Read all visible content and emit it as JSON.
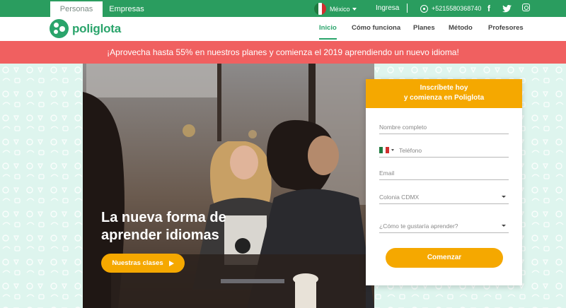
{
  "topbar": {
    "tabs": [
      {
        "label": "Personas",
        "active": true
      },
      {
        "label": "Empresas",
        "active": false
      }
    ],
    "country": "México",
    "login": "Ingresa",
    "phone": "+5215580368740",
    "social": [
      "facebook-icon",
      "twitter-icon",
      "instagram-icon"
    ],
    "facebook_glyph": "f"
  },
  "brand": {
    "name": "poliglota",
    "primary_color": "#2aa46b",
    "accent_color": "#f5a800",
    "promo_color": "#f06060"
  },
  "nav": {
    "items": [
      {
        "label": "Inicio",
        "active": true
      },
      {
        "label": "Cómo funciona",
        "active": false
      },
      {
        "label": "Planes",
        "active": false
      },
      {
        "label": "Método",
        "active": false
      },
      {
        "label": "Profesores",
        "active": false
      }
    ]
  },
  "promo": {
    "text": "¡Aprovecha hasta 55% en nuestros planes y comienza el 2019 aprendiendo un nuevo idioma!"
  },
  "hero": {
    "headline": "La nueva forma de aprender idiomas",
    "cta": "Nuestras clases"
  },
  "form": {
    "title_line1": "Inscríbete hoy",
    "title_line2": "y comienza en Poliglota",
    "name_placeholder": "Nombre completo",
    "phone_placeholder": "Teléfono",
    "email_placeholder": "Email",
    "location_value": "Colonia CDMX",
    "language_placeholder": "¿Cómo te gustaría aprender?",
    "submit": "Comenzar"
  }
}
